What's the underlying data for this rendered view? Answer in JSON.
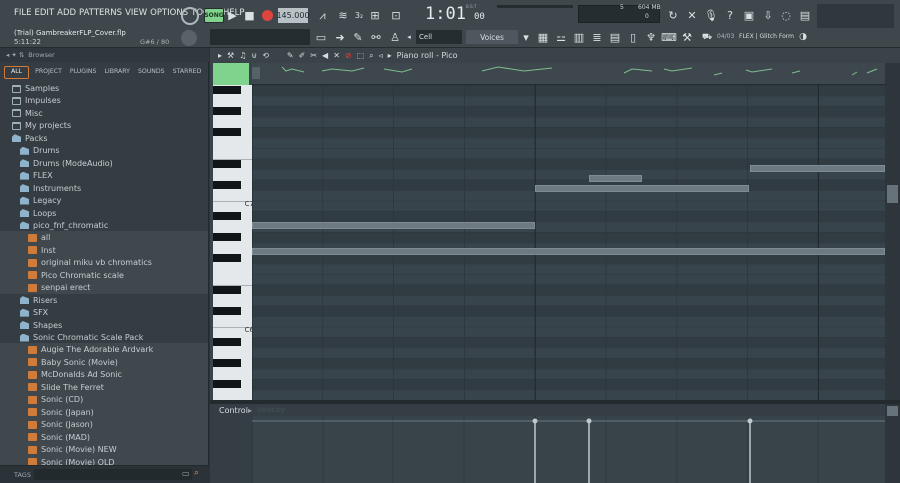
{
  "menu": [
    "FILE",
    "EDIT",
    "ADD",
    "PATTERNS",
    "VIEW",
    "OPTIONS",
    "TOOLS",
    "HELP"
  ],
  "transport": {
    "song_label": "SONG",
    "tempo": "145.000",
    "time": "1:01",
    "time_sub": "00",
    "bst": "B:S:T"
  },
  "cpu": {
    "voices": "5",
    "memory": "604 MB",
    "load": "0"
  },
  "project": {
    "file": "(Trial) GambreakerFLP_Cover.flp",
    "time": "5:11:22",
    "pitch": "G#6 / 80"
  },
  "snap": {
    "mode": "Cell",
    "voices_label": "Voices"
  },
  "hint": {
    "id": "04/03",
    "text": "FLEX | Glitch Form"
  },
  "browser": {
    "title": "Browser",
    "tabs": [
      "ALL",
      "PROJECT",
      "PLUGINS",
      "LIBRARY",
      "SOUNDS",
      "STARRED"
    ],
    "footer": "TAGS",
    "items": [
      {
        "label": "Samples",
        "kind": "folder",
        "indent": 0
      },
      {
        "label": "Impulses",
        "kind": "folder",
        "indent": 0
      },
      {
        "label": "Misc",
        "kind": "folder",
        "indent": 0
      },
      {
        "label": "My projects",
        "kind": "folder",
        "indent": 0
      },
      {
        "label": "Packs",
        "kind": "pack",
        "indent": 0
      },
      {
        "label": "Drums",
        "kind": "pack",
        "indent": 1
      },
      {
        "label": "Drums (ModeAudio)",
        "kind": "pack",
        "indent": 1
      },
      {
        "label": "FLEX",
        "kind": "pack",
        "indent": 1
      },
      {
        "label": "Instruments",
        "kind": "pack",
        "indent": 1
      },
      {
        "label": "Legacy",
        "kind": "pack",
        "indent": 1
      },
      {
        "label": "Loops",
        "kind": "pack",
        "indent": 1
      },
      {
        "label": "pico_fnf_chromatic",
        "kind": "pack",
        "indent": 1
      },
      {
        "label": "all",
        "kind": "file",
        "indent": 2
      },
      {
        "label": "Inst",
        "kind": "file",
        "indent": 2
      },
      {
        "label": "original miku vb chromatics",
        "kind": "file",
        "indent": 2
      },
      {
        "label": "Pico Chromatic scale",
        "kind": "file",
        "indent": 2
      },
      {
        "label": "senpai erect",
        "kind": "file",
        "indent": 2
      },
      {
        "label": "Risers",
        "kind": "pack",
        "indent": 1
      },
      {
        "label": "SFX",
        "kind": "pack",
        "indent": 1
      },
      {
        "label": "Shapes",
        "kind": "pack",
        "indent": 1
      },
      {
        "label": "Sonic Chromatic Scale Pack",
        "kind": "pack",
        "indent": 1
      },
      {
        "label": "Augie The Adorable Ardvark",
        "kind": "file",
        "indent": 2
      },
      {
        "label": "Baby Sonic (Movie)",
        "kind": "file",
        "indent": 2
      },
      {
        "label": "McDonalds Ad Sonic",
        "kind": "file",
        "indent": 2
      },
      {
        "label": "Slide The Ferret",
        "kind": "file",
        "indent": 2
      },
      {
        "label": "Sonic (CD)",
        "kind": "file",
        "indent": 2
      },
      {
        "label": "Sonic (Japan)",
        "kind": "file",
        "indent": 2
      },
      {
        "label": "Sonic (Jason)",
        "kind": "file",
        "indent": 2
      },
      {
        "label": "Sonic (MAD)",
        "kind": "file",
        "indent": 2
      },
      {
        "label": "Sonic (Movie) NEW",
        "kind": "file",
        "indent": 2
      },
      {
        "label": "Sonic (Movie) OLD",
        "kind": "file",
        "indent": 2
      }
    ]
  },
  "pianoroll": {
    "title": "Piano roll - Pico",
    "key_c7": "C7",
    "key_c6": "C6",
    "control_label": "Control",
    "control_param": "Velocity"
  },
  "colors": {
    "accent_green": "#7fd38c",
    "record_red": "#e0443e",
    "note": "#6d7a82"
  }
}
